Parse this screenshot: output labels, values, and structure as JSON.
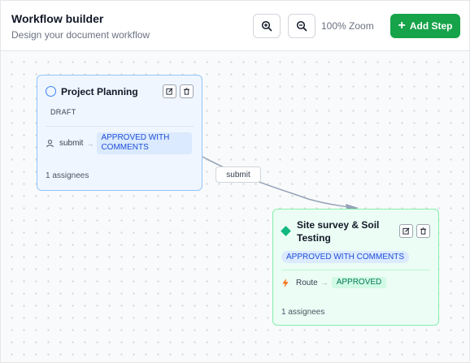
{
  "header": {
    "title": "Workflow builder",
    "subtitle": "Design your document workflow",
    "zoom_in_icon": "zoom-in-icon",
    "zoom_out_icon": "zoom-out-icon",
    "zoom_label": "100% Zoom",
    "add_step_label": "Add Step"
  },
  "edge": {
    "label": "submit"
  },
  "nodes": [
    {
      "title": "Project Planning",
      "status": "DRAFT",
      "action": {
        "label": "submit",
        "target": "APPROVED WITH COMMENTS"
      },
      "assignees": "1 assignees"
    },
    {
      "title": "Site survey & Soil Testing",
      "status": "APPROVED WITH COMMENTS",
      "action": {
        "label": "Route",
        "target": "APPROVED"
      },
      "assignees": "1 assignees"
    }
  ],
  "colors": {
    "accent_green": "#16a34a",
    "node_blue_bg": "#eff6ff",
    "node_blue_border": "#93c5fd",
    "node_green_bg": "#ecfdf5",
    "node_green_border": "#86efac",
    "edge": "#94a3b8"
  }
}
